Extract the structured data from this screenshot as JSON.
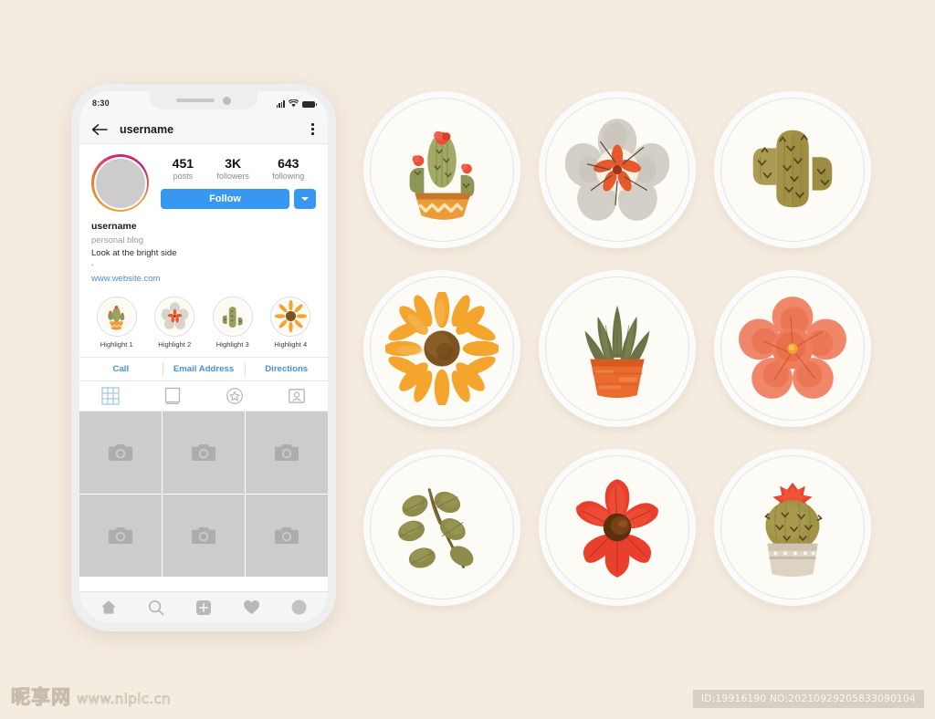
{
  "background_color": "#f5ece1",
  "phone": {
    "status_bar": {
      "time": "8:30",
      "icons": [
        "signal-icon",
        "wifi-icon",
        "battery-icon"
      ]
    },
    "top_nav": {
      "back_icon": "arrow-left-icon",
      "title": "username",
      "menu_icon": "kebab-menu-icon"
    },
    "profile": {
      "avatar_alt": "profile-avatar",
      "stats": [
        {
          "value": "451",
          "label": "posts"
        },
        {
          "value": "3K",
          "label": "followers"
        },
        {
          "value": "643",
          "label": "following"
        }
      ],
      "follow_label": "Follow",
      "dropdown_icon": "chevron-down-icon",
      "accent_color": "#3897f0",
      "bio": {
        "name": "username",
        "category": "personal blog",
        "description": "Look at the bright side",
        "dot": ".",
        "website": "www.website.com",
        "link_color": "#4a8fd0"
      }
    },
    "highlights": [
      {
        "label": "Highlight 1",
        "art": "cactus-pot"
      },
      {
        "label": "Highlight 2",
        "art": "white-flower"
      },
      {
        "label": "Highlight 3",
        "art": "tall-cactus"
      },
      {
        "label": "Highlight 4",
        "art": "sunflower"
      }
    ],
    "actions": [
      "Call",
      "Email Address",
      "Directions"
    ],
    "tabs": [
      {
        "icon": "grid-icon",
        "selected": true
      },
      {
        "icon": "reels-icon",
        "selected": false
      },
      {
        "icon": "star-badge-icon",
        "selected": false
      },
      {
        "icon": "tagged-icon",
        "selected": false
      }
    ],
    "photo_grid": {
      "placeholder_icon": "camera-icon",
      "cells": 6,
      "placeholder_color": "#cccccc"
    },
    "bottom_nav": [
      {
        "icon": "home-icon"
      },
      {
        "icon": "search-icon"
      },
      {
        "icon": "add-post-icon"
      },
      {
        "icon": "heart-icon"
      },
      {
        "icon": "profile-avatar-icon"
      }
    ]
  },
  "stickers": [
    {
      "name": "cactus-in-zigzag-pot",
      "art": "cactus-pot"
    },
    {
      "name": "white-magnolia-flower",
      "art": "white-flower"
    },
    {
      "name": "tall-saguaro-cactus",
      "art": "tall-cactus"
    },
    {
      "name": "orange-sunflower",
      "art": "sunflower"
    },
    {
      "name": "aloe-in-terracotta-pot",
      "art": "aloe-pot"
    },
    {
      "name": "coral-poppy-flower",
      "art": "coral-flower"
    },
    {
      "name": "olive-leaf-branch",
      "art": "leaf-branch"
    },
    {
      "name": "red-cosmos-flower",
      "art": "red-flower"
    },
    {
      "name": "round-cactus-in-pot",
      "art": "round-cactus"
    }
  ],
  "watermark": {
    "logo_cn": "昵享网",
    "logo_url": "www.nipic.cn",
    "id_text": "ID:19916190 NO:20210929205833090104"
  }
}
